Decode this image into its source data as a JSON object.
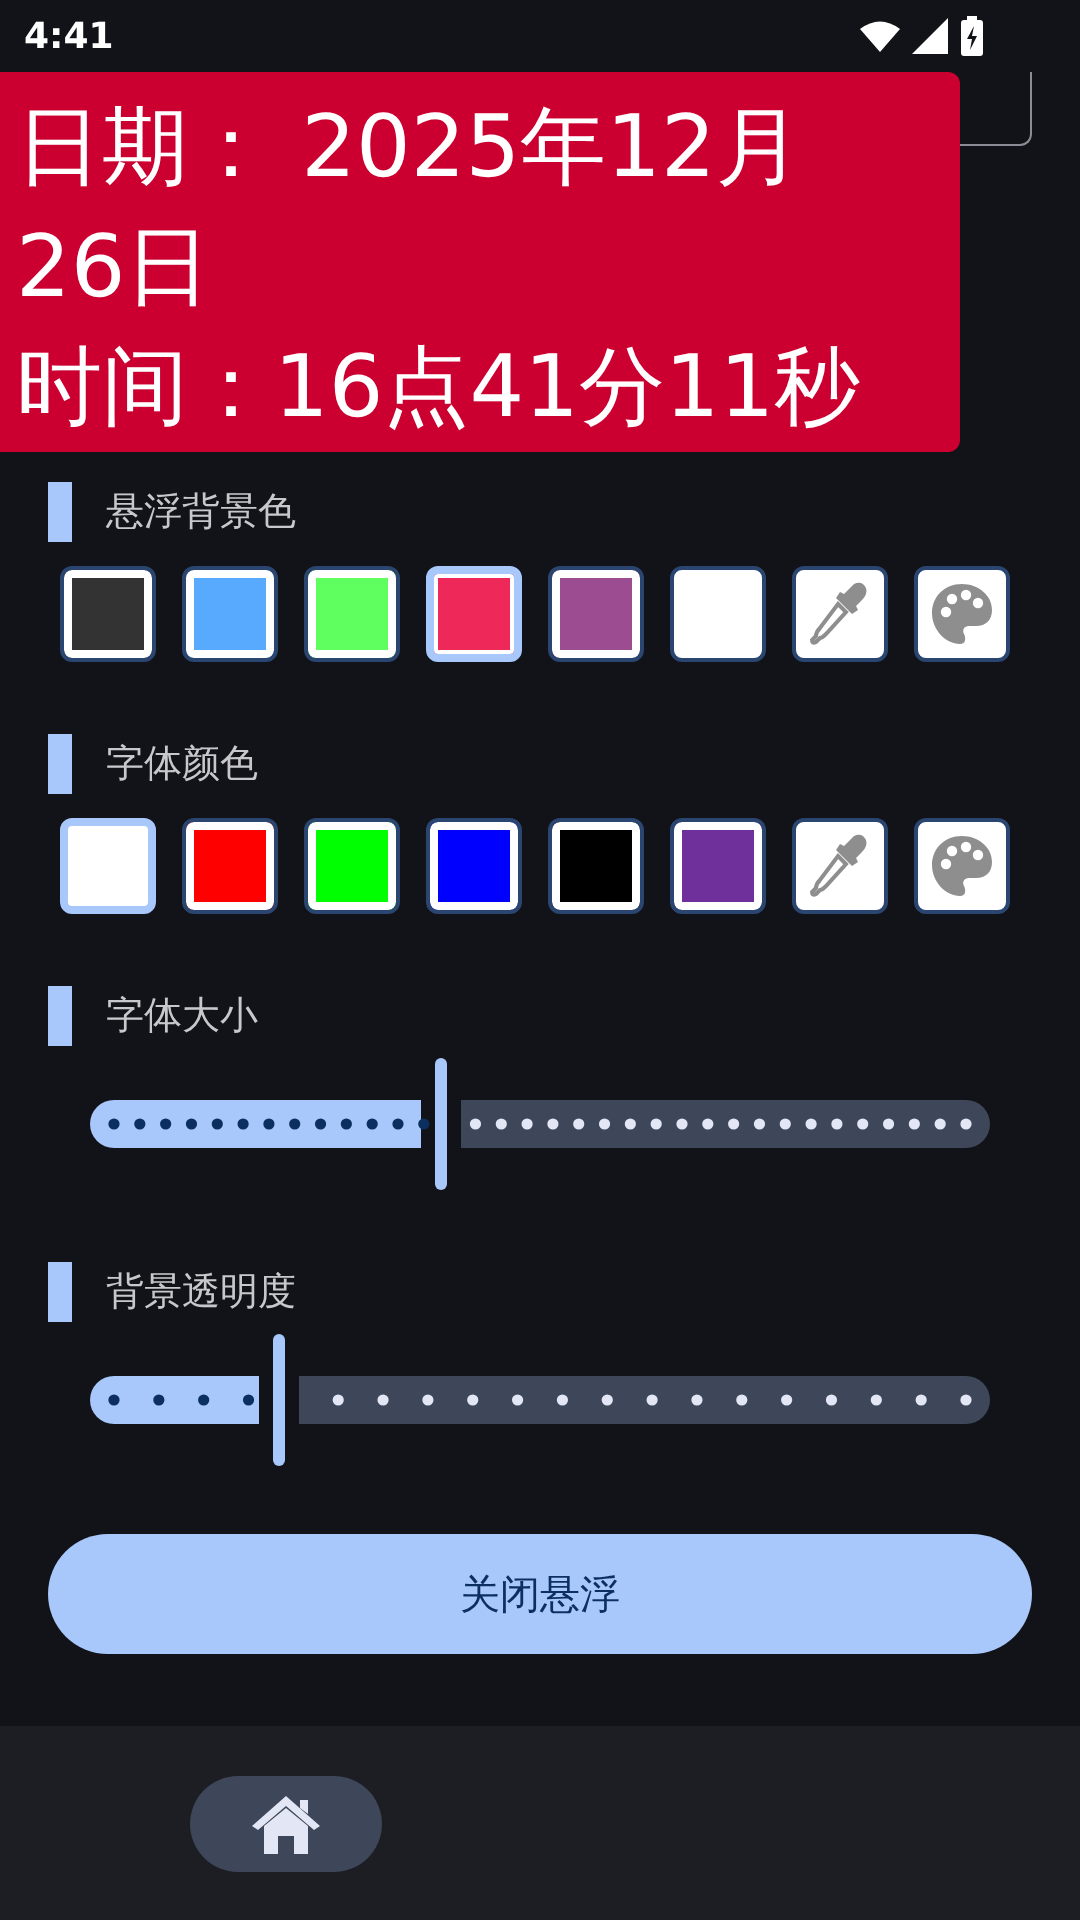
{
  "status_bar": {
    "time": "4:41"
  },
  "overlay": {
    "lines": [
      "日期： 2025年12月26日",
      "时间：16点41分11秒"
    ]
  },
  "background_color": {
    "title": "悬浮背景色",
    "swatches": [
      {
        "kind": "color",
        "color": "#333333",
        "selected": false
      },
      {
        "kind": "color",
        "color": "#58aaff",
        "selected": false
      },
      {
        "kind": "color",
        "color": "#60ff60",
        "selected": false
      },
      {
        "kind": "color",
        "color": "#ee2858",
        "selected": true
      },
      {
        "kind": "color",
        "color": "#9c4c90",
        "selected": false
      },
      {
        "kind": "color",
        "color": "#ffffff",
        "selected": false
      },
      {
        "kind": "eyedropper",
        "selected": false
      },
      {
        "kind": "palette",
        "selected": false
      }
    ]
  },
  "font_color": {
    "title": "字体颜色",
    "swatches": [
      {
        "kind": "color",
        "color": "#ffffff",
        "selected": true
      },
      {
        "kind": "color",
        "color": "#ff0000",
        "selected": false
      },
      {
        "kind": "color",
        "color": "#00ff00",
        "selected": false
      },
      {
        "kind": "color",
        "color": "#0000ff",
        "selected": false
      },
      {
        "kind": "color",
        "color": "#000000",
        "selected": false
      },
      {
        "kind": "color",
        "color": "#70309c",
        "selected": false
      },
      {
        "kind": "eyedropper",
        "selected": false
      },
      {
        "kind": "palette",
        "selected": false
      }
    ]
  },
  "sliders": [
    {
      "title": "字体大小",
      "level": 0.39
    },
    {
      "title": "背景透明度",
      "level": 0.21
    }
  ],
  "close_button": "关闭悬浮",
  "bottom_nav": [
    {
      "kind": "home",
      "selected": true
    }
  ]
}
